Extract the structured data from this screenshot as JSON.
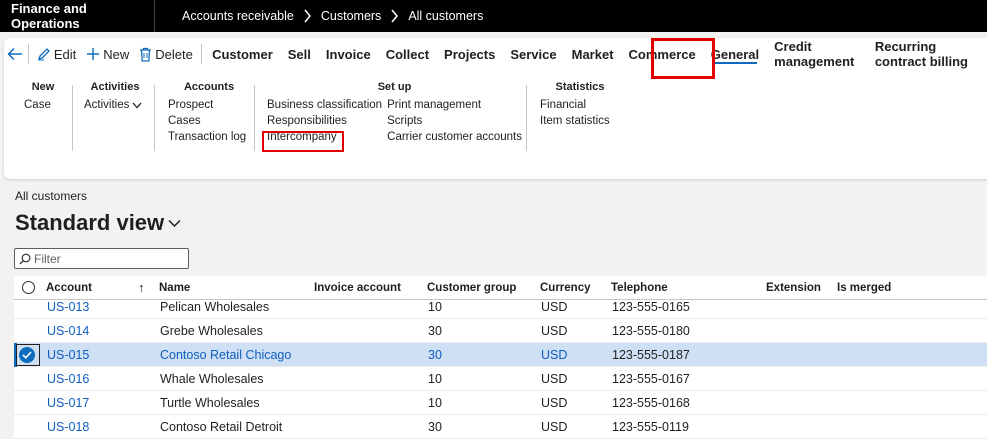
{
  "topbar": {
    "app_title": "Finance and Operations",
    "breadcrumbs": [
      "Accounts receivable",
      "Customers",
      "All customers"
    ]
  },
  "actions": {
    "edit": "Edit",
    "new": "New",
    "delete": "Delete"
  },
  "tabs": [
    "Customer",
    "Sell",
    "Invoice",
    "Collect",
    "Projects",
    "Service",
    "Market",
    "Commerce",
    "General",
    "Credit management",
    "Recurring contract billing"
  ],
  "active_tab": "General",
  "ribbon": {
    "new": {
      "title": "New",
      "items": [
        "Case"
      ]
    },
    "activities": {
      "title": "Activities",
      "items": [
        "Activities"
      ]
    },
    "accounts": {
      "title": "Accounts",
      "items": [
        "Prospect",
        "Cases",
        "Transaction log"
      ]
    },
    "setup": {
      "title": "Set up",
      "col1": [
        "Business classification",
        "Responsibilities",
        "Intercompany"
      ],
      "col2": [
        "Print management",
        "Scripts",
        "Carrier customer accounts"
      ]
    },
    "statistics": {
      "title": "Statistics",
      "items": [
        "Financial",
        "Item statistics"
      ]
    }
  },
  "page": {
    "caption": "All customers",
    "view_name": "Standard view",
    "filter_placeholder": "Filter"
  },
  "grid": {
    "columns": [
      "Account",
      "Name",
      "Invoice account",
      "Customer group",
      "Currency",
      "Telephone",
      "Extension",
      "Is merged"
    ],
    "sort_indicator": "↑",
    "rows": [
      {
        "account": "US-013",
        "name": "Pelican Wholesales",
        "invoice": "",
        "group": "10",
        "currency": "USD",
        "phone": "123-555-0165",
        "selected": false
      },
      {
        "account": "US-014",
        "name": "Grebe Wholesales",
        "invoice": "",
        "group": "30",
        "currency": "USD",
        "phone": "123-555-0180",
        "selected": false
      },
      {
        "account": "US-015",
        "name": "Contoso Retail Chicago",
        "invoice": "",
        "group": "30",
        "currency": "USD",
        "phone": "123-555-0187",
        "selected": true
      },
      {
        "account": "US-016",
        "name": "Whale Wholesales",
        "invoice": "",
        "group": "10",
        "currency": "USD",
        "phone": "123-555-0167",
        "selected": false
      },
      {
        "account": "US-017",
        "name": "Turtle Wholesales",
        "invoice": "",
        "group": "10",
        "currency": "USD",
        "phone": "123-555-0168",
        "selected": false
      },
      {
        "account": "US-018",
        "name": "Contoso Retail Detroit",
        "invoice": "",
        "group": "30",
        "currency": "USD",
        "phone": "123-555-0119",
        "selected": false
      }
    ]
  },
  "colors": {
    "accent": "#0f6cbd",
    "highlight": "#e00000",
    "selected_row": "#cfe0f5"
  }
}
